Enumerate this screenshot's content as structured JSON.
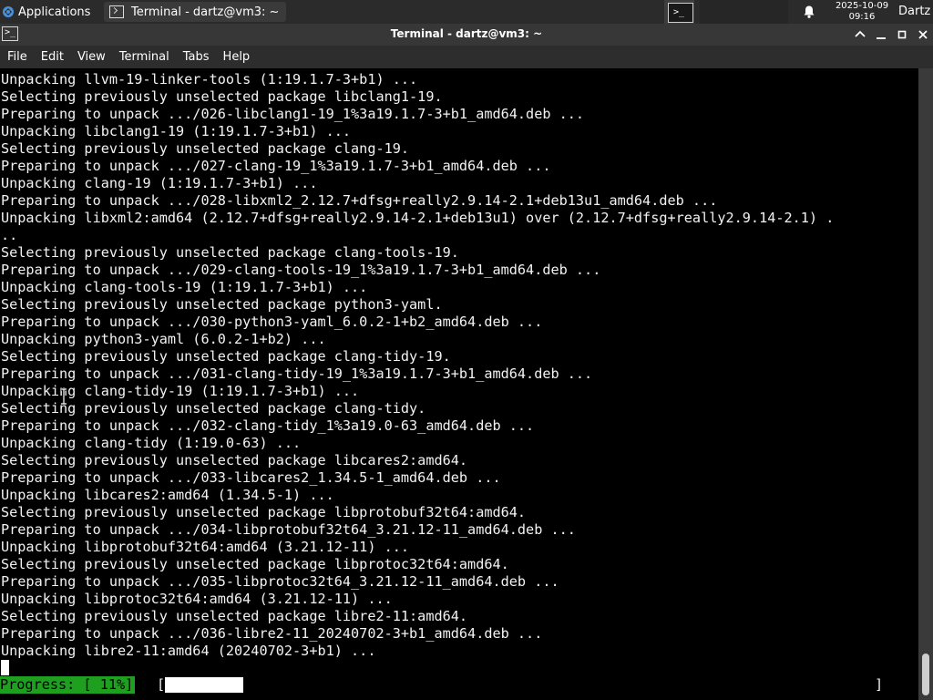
{
  "panel": {
    "apps_label": "Applications",
    "task_label": "Terminal - dartz@vm3: ~",
    "clock_date": "2025-10-09",
    "clock_time": "09:16",
    "user": "Dartz"
  },
  "window": {
    "title": "Terminal - dartz@vm3: ~"
  },
  "menu": [
    "File",
    "Edit",
    "View",
    "Terminal",
    "Tabs",
    "Help"
  ],
  "terminal": {
    "lines": [
      "Unpacking llvm-19-linker-tools (1:19.1.7-3+b1) ...",
      "Selecting previously unselected package libclang1-19.",
      "Preparing to unpack .../026-libclang1-19_1%3a19.1.7-3+b1_amd64.deb ...",
      "Unpacking libclang1-19 (1:19.1.7-3+b1) ...",
      "Selecting previously unselected package clang-19.",
      "Preparing to unpack .../027-clang-19_1%3a19.1.7-3+b1_amd64.deb ...",
      "Unpacking clang-19 (1:19.1.7-3+b1) ...",
      "Preparing to unpack .../028-libxml2_2.12.7+dfsg+really2.9.14-2.1+deb13u1_amd64.deb ...",
      "Unpacking libxml2:amd64 (2.12.7+dfsg+really2.9.14-2.1+deb13u1) over (2.12.7+dfsg+really2.9.14-2.1) .",
      "..",
      "Selecting previously unselected package clang-tools-19.",
      "Preparing to unpack .../029-clang-tools-19_1%3a19.1.7-3+b1_amd64.deb ...",
      "Unpacking clang-tools-19 (1:19.1.7-3+b1) ...",
      "Selecting previously unselected package python3-yaml.",
      "Preparing to unpack .../030-python3-yaml_6.0.2-1+b2_amd64.deb ...",
      "Unpacking python3-yaml (6.0.2-1+b2) ...",
      "Selecting previously unselected package clang-tidy-19.",
      "Preparing to unpack .../031-clang-tidy-19_1%3a19.1.7-3+b1_amd64.deb ...",
      "Unpacking clang-tidy-19 (1:19.1.7-3+b1) ...",
      "Selecting previously unselected package clang-tidy.",
      "Preparing to unpack .../032-clang-tidy_1%3a19.0-63_amd64.deb ...",
      "Unpacking clang-tidy (1:19.0-63) ...",
      "Selecting previously unselected package libcares2:amd64.",
      "Preparing to unpack .../033-libcares2_1.34.5-1_amd64.deb ...",
      "Unpacking libcares2:amd64 (1.34.5-1) ...",
      "Selecting previously unselected package libprotobuf32t64:amd64.",
      "Preparing to unpack .../034-libprotobuf32t64_3.21.12-11_amd64.deb ...",
      "Unpacking libprotobuf32t64:amd64 (3.21.12-11) ...",
      "Selecting previously unselected package libprotoc32t64:amd64.",
      "Preparing to unpack .../035-libprotoc32t64_3.21.12-11_amd64.deb ...",
      "Unpacking libprotoc32t64:amd64 (3.21.12-11) ...",
      "Selecting previously unselected package libre2-11:amd64.",
      "Preparing to unpack .../036-libre2-11_20240702-3+b1_amd64.deb ...",
      "Unpacking libre2-11:amd64 (20240702-3+b1) ..."
    ],
    "progress_label": "Progress: [ 11%]",
    "progress_open": "[",
    "progress_close": "]",
    "progress_fraction": 0.11
  },
  "colors": {
    "progress_label_bg": "#1f9f1f",
    "terminal_bg": "#000000",
    "terminal_fg": "#f2f2f2"
  }
}
